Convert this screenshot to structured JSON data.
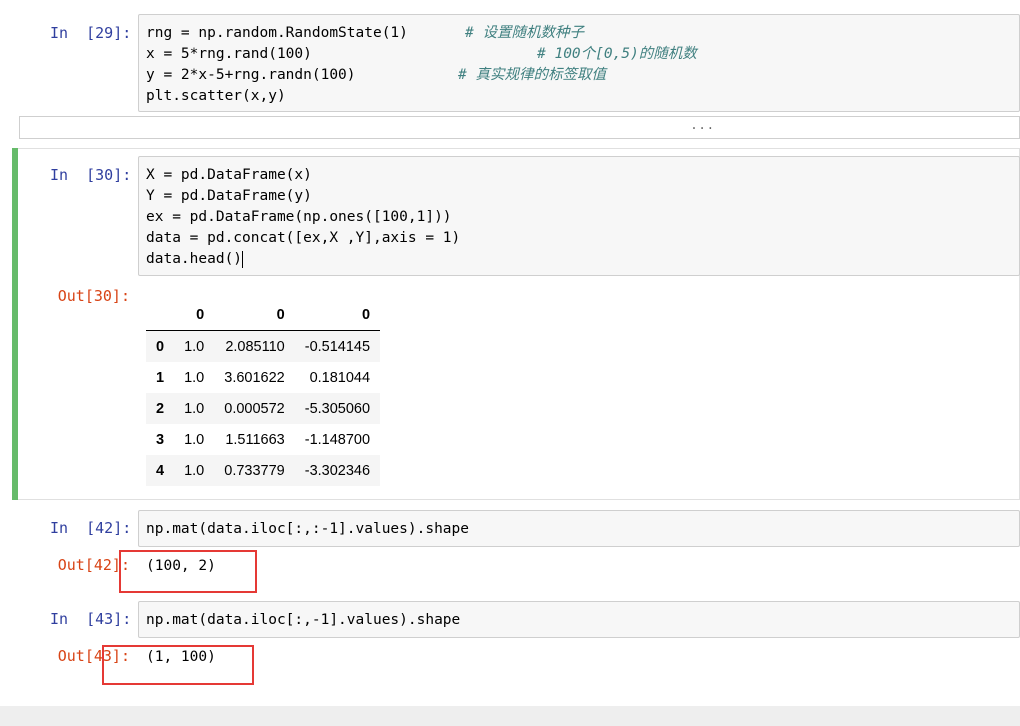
{
  "cells": [
    {
      "prompt": "In  [29]:",
      "lines": [
        {
          "code": "rng = np.random.RandomState(1)",
          "comment": "# 设置随机数种子"
        },
        {
          "code": "x = 5*rng.rand(100)",
          "comment": "# 100个[0,5)的随机数"
        },
        {
          "code": "y = 2*x-5+rng.randn(100)",
          "comment": "# 真实规律的标签取值"
        },
        {
          "code": "plt.scatter(x,y)",
          "comment": ""
        }
      ],
      "collapsed_output": "..."
    },
    {
      "prompt": "In  [30]:",
      "lines": [
        {
          "code": "X = pd.DataFrame(x)"
        },
        {
          "code": "Y = pd.DataFrame(y)"
        },
        {
          "code": "ex = pd.DataFrame(np.ones([100,1]))"
        },
        {
          "code": "data = pd.concat([ex,X ,Y],axis = 1)"
        },
        {
          "code": "data.head()"
        }
      ],
      "out_prompt": "Out[30]:",
      "table": {
        "columns": [
          "",
          "0",
          "0",
          "0"
        ],
        "rows": [
          [
            "0",
            "1.0",
            "2.085110",
            "-0.514145"
          ],
          [
            "1",
            "1.0",
            "3.601622",
            "0.181044"
          ],
          [
            "2",
            "1.0",
            "0.000572",
            "-5.305060"
          ],
          [
            "3",
            "1.0",
            "1.511663",
            "-1.148700"
          ],
          [
            "4",
            "1.0",
            "0.733779",
            "-3.302346"
          ]
        ]
      }
    },
    {
      "prompt": "In  [42]:",
      "code": "np.mat(data.iloc[:,:-1].values).shape",
      "out_prompt": "Out[42]:",
      "output": "(100, 2)"
    },
    {
      "prompt": "In  [43]:",
      "code": "np.mat(data.iloc[:,-1].values).shape",
      "out_prompt": "Out[43]:",
      "output": "(1, 100)"
    }
  ],
  "colors": {
    "in_prompt": "#303f9f",
    "out_prompt": "#d84315",
    "selected_cell": "#66bb6a",
    "annotation_box": "#e53935",
    "comment": "#408080"
  }
}
